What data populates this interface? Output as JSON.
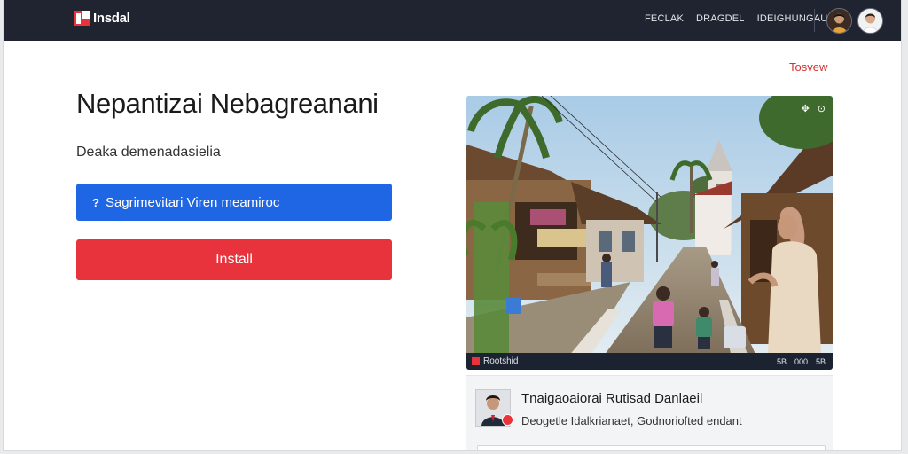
{
  "header": {
    "logo_text": "Insdal",
    "nav": [
      "FECLAK",
      "DRAGDEL",
      "IDEIGHUNGAUNG"
    ]
  },
  "main": {
    "preview_label": "Tosvew",
    "title": "Nepantizai Nebagreanani",
    "subtitle": "Deaka demenadasielia",
    "primary_button": {
      "icon": "?",
      "label": "Sagrimevitari Viren meamiroc"
    },
    "install_button": {
      "label": "Install"
    }
  },
  "media": {
    "channel_name": "Rootshid",
    "controls": [
      "5B",
      "000",
      "5B"
    ]
  },
  "info_card": {
    "title": "Tnaigaoaiorai Rutisad Danlaeil",
    "subtitle": "Deogetle Idalkrianaet, Godnoriofted endant"
  },
  "icons": {
    "logo": "square-logo-icon",
    "media_top": [
      "share-icon",
      "more-icon"
    ],
    "media_bar": "channel-logo-icon",
    "info_badge": "verified-badge-icon"
  },
  "colors": {
    "topbar": "#1f2430",
    "primary": "#1f66e5",
    "danger": "#e8323c",
    "link": "#d63232"
  }
}
